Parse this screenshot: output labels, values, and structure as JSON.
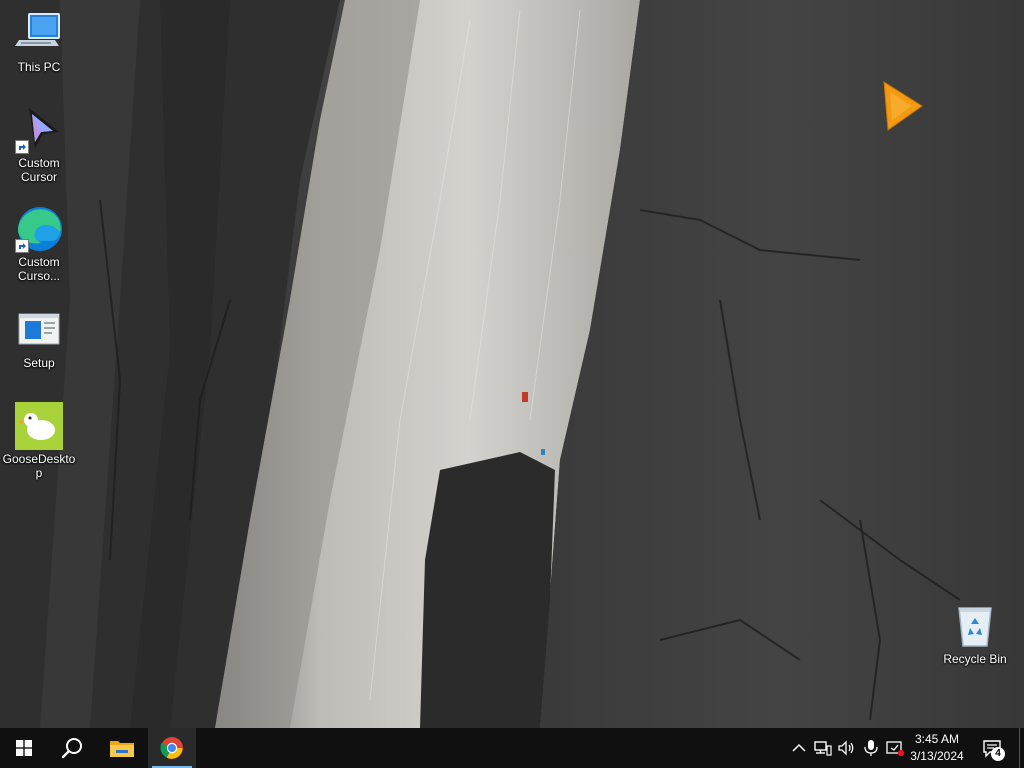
{
  "desktop": {
    "icons": [
      {
        "label": "This PC",
        "icon": "computer-icon"
      },
      {
        "label": "Custom Cursor",
        "icon": "custom-cursor-icon"
      },
      {
        "label": "Custom Curso...",
        "icon": "edge-icon"
      },
      {
        "label": "Setup",
        "icon": "setup-icon"
      },
      {
        "label": "GooseDesktop",
        "icon": "goose-icon"
      },
      {
        "label": "Recycle Bin",
        "icon": "recycle-bin-icon"
      }
    ],
    "cursor_icon": "orange-triangle-cursor-icon"
  },
  "taskbar": {
    "start_icon": "windows-logo-icon",
    "search_icon": "search-icon",
    "pinned": [
      {
        "name": "File Explorer",
        "icon": "file-explorer-icon"
      },
      {
        "name": "Google Chrome",
        "icon": "chrome-icon",
        "active": true
      }
    ],
    "tray": {
      "chevron_icon": "chevron-up-icon",
      "network_icon": "network-icon",
      "volume_icon": "volume-icon",
      "mic_icon": "microphone-icon",
      "extra_icon": "screen-record-icon"
    },
    "clock": {
      "time": "3:45 AM",
      "date": "3/13/2024"
    },
    "notifications": {
      "count": "4",
      "icon": "action-center-icon"
    }
  },
  "colors": {
    "taskbar_bg": "#101010",
    "active_underline": "#76b9ed",
    "rock_dark": "#3b3b3b",
    "rock_light": "#c9c8c4",
    "cursor_orange": "#f39a12"
  }
}
